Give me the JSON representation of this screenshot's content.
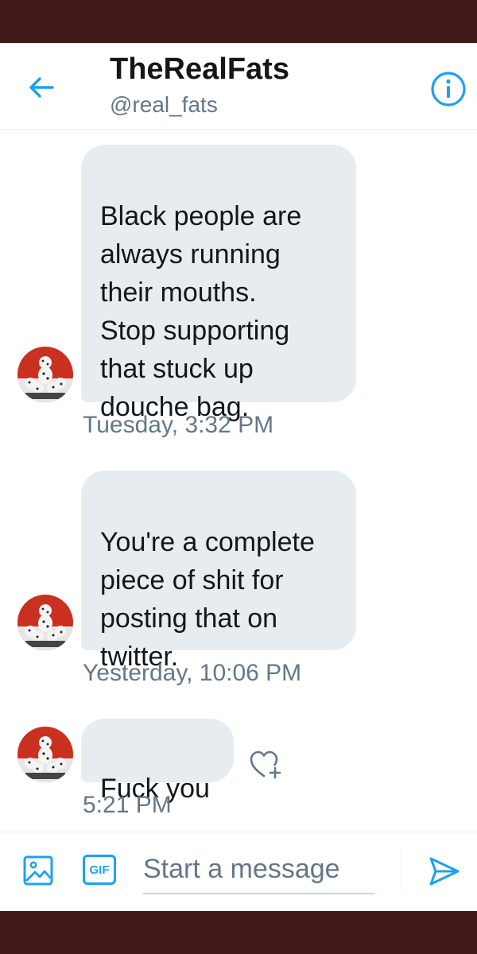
{
  "header": {
    "title": "TheRealFats",
    "handle": "@real_fats"
  },
  "messages": [
    {
      "text": "Black people are\nalways running\ntheir mouths.\nStop supporting\nthat stuck up\ndouche bag.",
      "timestamp": "Tuesday, 3:32 PM"
    },
    {
      "text": "You're a complete\npiece of shit for\nposting that on\ntwitter.",
      "timestamp": "Yesterday, 10:06 PM"
    },
    {
      "text": "Fuck you",
      "timestamp": "5:21 PM"
    }
  ],
  "composer": {
    "gif_label": "GIF",
    "placeholder": "Start a message"
  },
  "colors": {
    "accent": "#1da1f2",
    "bubble": "#e6ecf0",
    "frame": "#411717",
    "muted_text": "#657786"
  }
}
